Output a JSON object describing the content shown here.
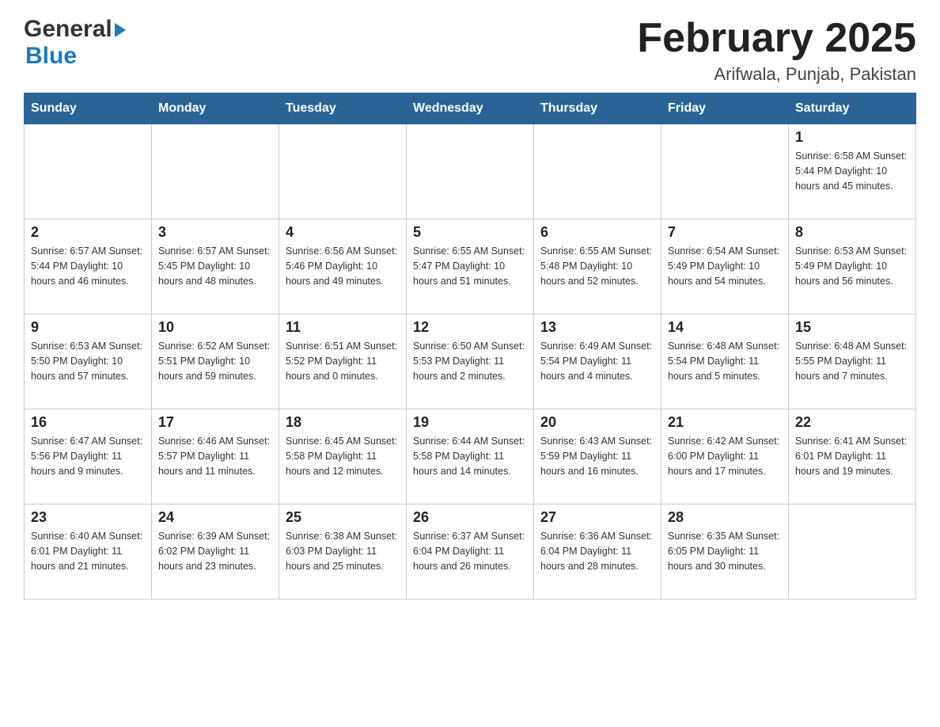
{
  "header": {
    "title": "February 2025",
    "subtitle": "Arifwala, Punjab, Pakistan",
    "logo_general": "General",
    "logo_blue": "Blue"
  },
  "days_of_week": [
    "Sunday",
    "Monday",
    "Tuesday",
    "Wednesday",
    "Thursday",
    "Friday",
    "Saturday"
  ],
  "weeks": [
    [
      {
        "day": "",
        "info": ""
      },
      {
        "day": "",
        "info": ""
      },
      {
        "day": "",
        "info": ""
      },
      {
        "day": "",
        "info": ""
      },
      {
        "day": "",
        "info": ""
      },
      {
        "day": "",
        "info": ""
      },
      {
        "day": "1",
        "info": "Sunrise: 6:58 AM\nSunset: 5:44 PM\nDaylight: 10 hours\nand 45 minutes."
      }
    ],
    [
      {
        "day": "2",
        "info": "Sunrise: 6:57 AM\nSunset: 5:44 PM\nDaylight: 10 hours\nand 46 minutes."
      },
      {
        "day": "3",
        "info": "Sunrise: 6:57 AM\nSunset: 5:45 PM\nDaylight: 10 hours\nand 48 minutes."
      },
      {
        "day": "4",
        "info": "Sunrise: 6:56 AM\nSunset: 5:46 PM\nDaylight: 10 hours\nand 49 minutes."
      },
      {
        "day": "5",
        "info": "Sunrise: 6:55 AM\nSunset: 5:47 PM\nDaylight: 10 hours\nand 51 minutes."
      },
      {
        "day": "6",
        "info": "Sunrise: 6:55 AM\nSunset: 5:48 PM\nDaylight: 10 hours\nand 52 minutes."
      },
      {
        "day": "7",
        "info": "Sunrise: 6:54 AM\nSunset: 5:49 PM\nDaylight: 10 hours\nand 54 minutes."
      },
      {
        "day": "8",
        "info": "Sunrise: 6:53 AM\nSunset: 5:49 PM\nDaylight: 10 hours\nand 56 minutes."
      }
    ],
    [
      {
        "day": "9",
        "info": "Sunrise: 6:53 AM\nSunset: 5:50 PM\nDaylight: 10 hours\nand 57 minutes."
      },
      {
        "day": "10",
        "info": "Sunrise: 6:52 AM\nSunset: 5:51 PM\nDaylight: 10 hours\nand 59 minutes."
      },
      {
        "day": "11",
        "info": "Sunrise: 6:51 AM\nSunset: 5:52 PM\nDaylight: 11 hours\nand 0 minutes."
      },
      {
        "day": "12",
        "info": "Sunrise: 6:50 AM\nSunset: 5:53 PM\nDaylight: 11 hours\nand 2 minutes."
      },
      {
        "day": "13",
        "info": "Sunrise: 6:49 AM\nSunset: 5:54 PM\nDaylight: 11 hours\nand 4 minutes."
      },
      {
        "day": "14",
        "info": "Sunrise: 6:48 AM\nSunset: 5:54 PM\nDaylight: 11 hours\nand 5 minutes."
      },
      {
        "day": "15",
        "info": "Sunrise: 6:48 AM\nSunset: 5:55 PM\nDaylight: 11 hours\nand 7 minutes."
      }
    ],
    [
      {
        "day": "16",
        "info": "Sunrise: 6:47 AM\nSunset: 5:56 PM\nDaylight: 11 hours\nand 9 minutes."
      },
      {
        "day": "17",
        "info": "Sunrise: 6:46 AM\nSunset: 5:57 PM\nDaylight: 11 hours\nand 11 minutes."
      },
      {
        "day": "18",
        "info": "Sunrise: 6:45 AM\nSunset: 5:58 PM\nDaylight: 11 hours\nand 12 minutes."
      },
      {
        "day": "19",
        "info": "Sunrise: 6:44 AM\nSunset: 5:58 PM\nDaylight: 11 hours\nand 14 minutes."
      },
      {
        "day": "20",
        "info": "Sunrise: 6:43 AM\nSunset: 5:59 PM\nDaylight: 11 hours\nand 16 minutes."
      },
      {
        "day": "21",
        "info": "Sunrise: 6:42 AM\nSunset: 6:00 PM\nDaylight: 11 hours\nand 17 minutes."
      },
      {
        "day": "22",
        "info": "Sunrise: 6:41 AM\nSunset: 6:01 PM\nDaylight: 11 hours\nand 19 minutes."
      }
    ],
    [
      {
        "day": "23",
        "info": "Sunrise: 6:40 AM\nSunset: 6:01 PM\nDaylight: 11 hours\nand 21 minutes."
      },
      {
        "day": "24",
        "info": "Sunrise: 6:39 AM\nSunset: 6:02 PM\nDaylight: 11 hours\nand 23 minutes."
      },
      {
        "day": "25",
        "info": "Sunrise: 6:38 AM\nSunset: 6:03 PM\nDaylight: 11 hours\nand 25 minutes."
      },
      {
        "day": "26",
        "info": "Sunrise: 6:37 AM\nSunset: 6:04 PM\nDaylight: 11 hours\nand 26 minutes."
      },
      {
        "day": "27",
        "info": "Sunrise: 6:36 AM\nSunset: 6:04 PM\nDaylight: 11 hours\nand 28 minutes."
      },
      {
        "day": "28",
        "info": "Sunrise: 6:35 AM\nSunset: 6:05 PM\nDaylight: 11 hours\nand 30 minutes."
      },
      {
        "day": "",
        "info": ""
      }
    ]
  ]
}
